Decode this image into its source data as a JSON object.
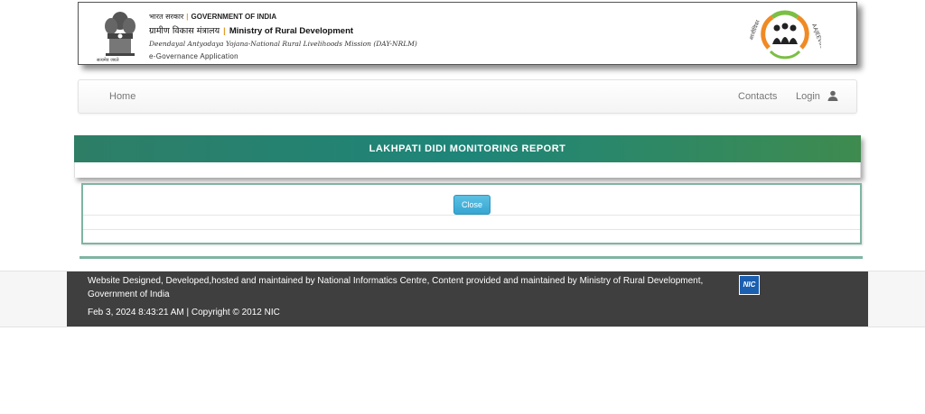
{
  "header": {
    "hindi_govt": "भारत सरकार",
    "govt": "GOVERNMENT OF INDIA",
    "hindi_ministry": "ग्रामीण विकास मंत्रालय",
    "ministry": "Ministry of Rural Development",
    "mission": "Deendayal Antyodaya Yojana-National Rural Livelihoods Mission (DAY-NRLM)",
    "app_name": "e-Governance Application",
    "emblem_caption": "सत्यमेव जयते",
    "logo_name": "aajeevika-logo"
  },
  "navbar": {
    "home": "Home",
    "contacts": "Contacts",
    "login": "Login"
  },
  "report": {
    "title": "LAKHPATI DIDI MONITORING REPORT",
    "close_label": "Close"
  },
  "footer": {
    "credits": "Website Designed, Developed,hosted and maintained by  National Informatics Centre, Content provided and maintained by Ministry of Rural Development, Government of India",
    "datetime_copyright": "Feb 3, 2024 8:43:21 AM | Copyright © 2012 NIC",
    "nic_logo_text": "NIC"
  },
  "colors": {
    "title_bar": "#1e8579",
    "close_button": "#36a6d2",
    "footer_bg": "#3f3f3f"
  }
}
